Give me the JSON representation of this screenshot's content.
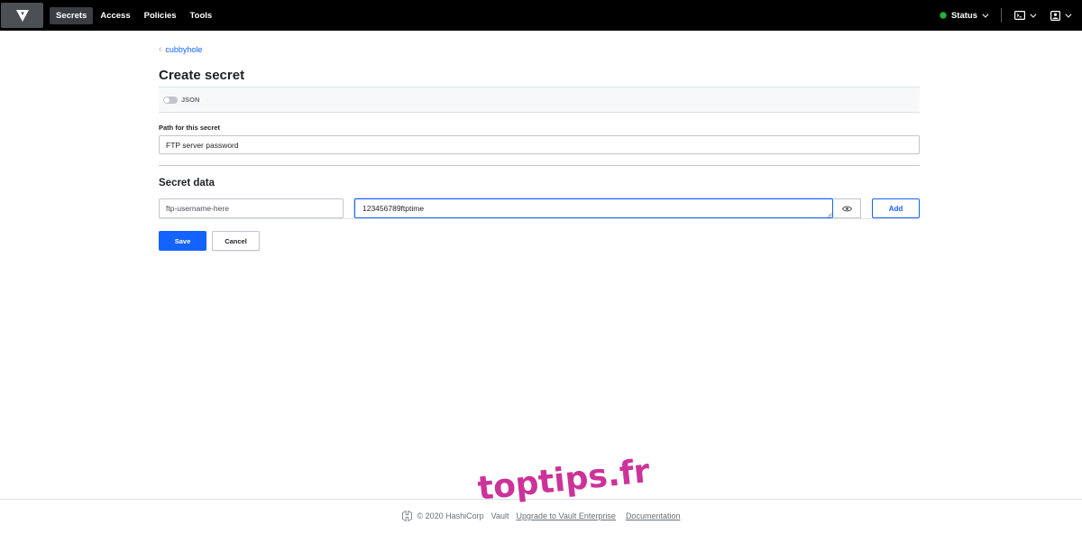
{
  "nav": {
    "items": [
      {
        "label": "Secrets",
        "active": true
      },
      {
        "label": "Access",
        "active": false
      },
      {
        "label": "Policies",
        "active": false
      },
      {
        "label": "Tools",
        "active": false
      }
    ],
    "status_label": "Status",
    "status_color": "#2eb039"
  },
  "breadcrumb": {
    "label": "cubbyhole"
  },
  "page_title": "Create secret",
  "json_toggle": {
    "label": "JSON",
    "on": false
  },
  "path": {
    "label": "Path for this secret",
    "value": "FTP server password"
  },
  "secret_data": {
    "title": "Secret data",
    "key_value": "ftp-username-here",
    "value_value": "123456789ftptime",
    "add_label": "Add"
  },
  "actions": {
    "save_label": "Save",
    "cancel_label": "Cancel"
  },
  "footer": {
    "copyright": "© 2020 HashiCorp",
    "version": "Vault",
    "upgrade_link": "Upgrade to Vault Enterprise",
    "docs_link": "Documentation"
  },
  "watermark": "toptips.fr",
  "colors": {
    "accent": "#1563ff",
    "nav_bg": "#000000",
    "watermark": "#cc3399"
  }
}
